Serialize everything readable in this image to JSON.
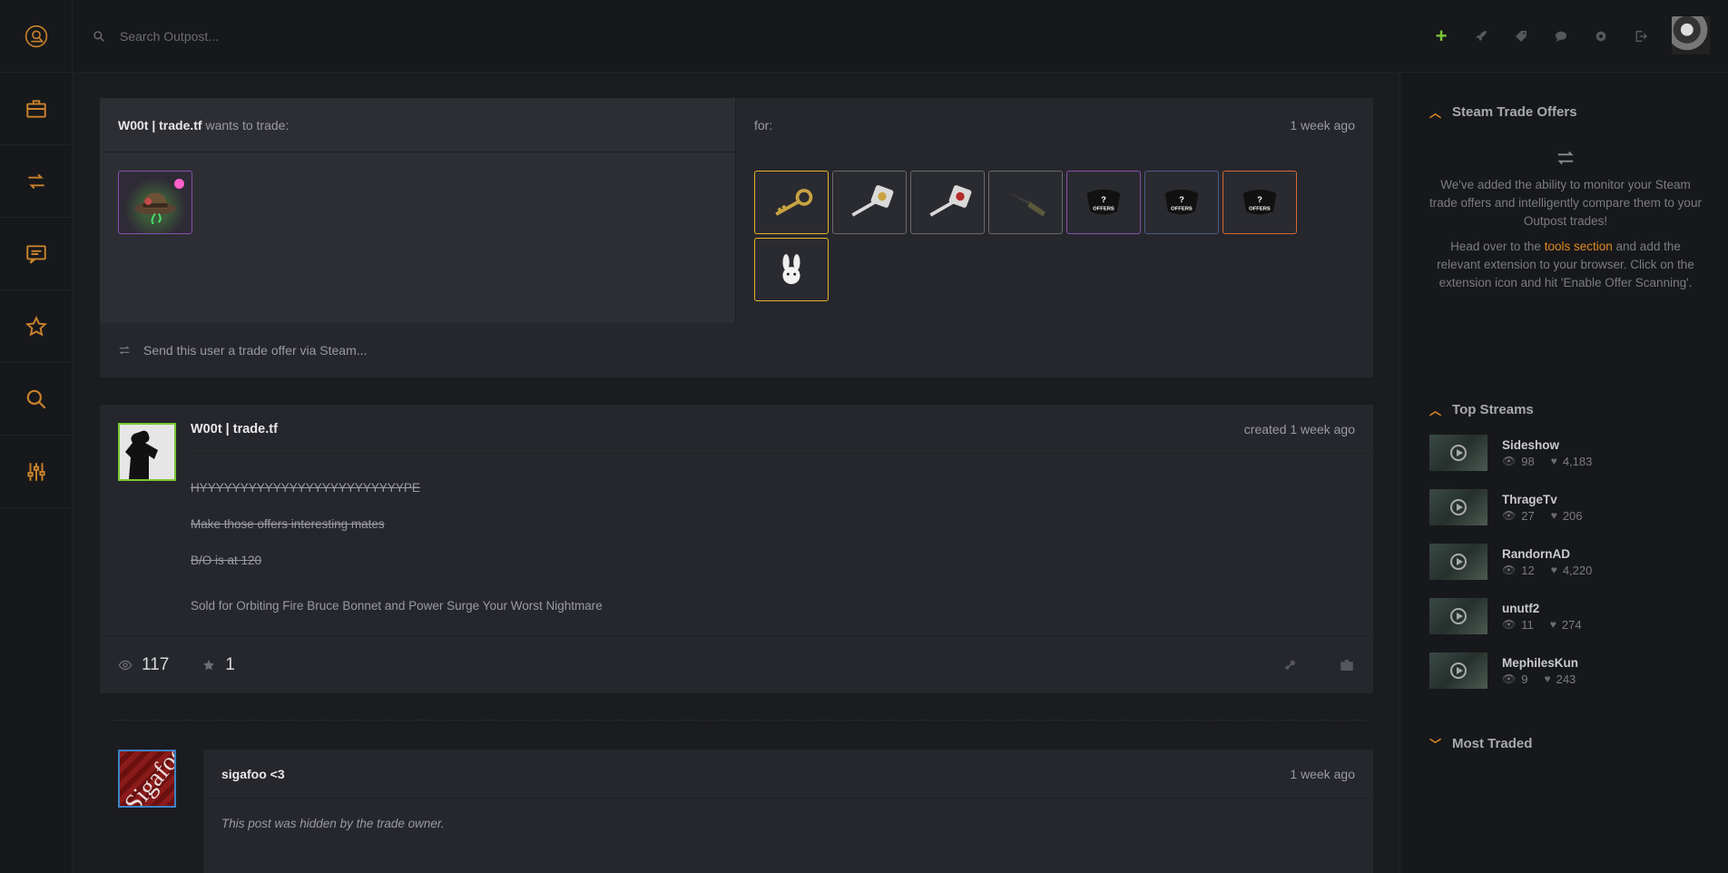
{
  "search": {
    "placeholder": "Search Outpost..."
  },
  "trade": {
    "user": "W00t | trade.tf",
    "wants_text": "wants to trade:",
    "for_text": "for:",
    "time": "1 week ago",
    "send_offer": "Send this user a trade offer via Steam..."
  },
  "post": {
    "user": "W00t | trade.tf",
    "created": "created 1 week ago",
    "lines": {
      "l1": "HYYYYYYYYYYYYYYYYYYYYYYYYYPE",
      "l2": "Make those offers interesting mates",
      "l3": "B/O is at 120",
      "l4": "Sold for Orbiting Fire Bruce Bonnet and Power Surge Your Worst Nightmare"
    },
    "views": "117",
    "stars": "1"
  },
  "comment": {
    "user": "sigafoo <3",
    "time": "1 week ago",
    "body": "This post was hidden by the trade owner.",
    "avatar_text": "Sigafoo"
  },
  "sidebar": {
    "steam_offers": {
      "title": "Steam Trade Offers",
      "p1": "We've added the ability to monitor your Steam trade offers and intelligently compare them to your Outpost trades!",
      "p2_a": "Head over to the",
      "p2_link": "tools section",
      "p2_b": "and add the relevant extension to your browser. Click on the extension icon and hit 'Enable Offer Scanning'."
    },
    "top_streams": {
      "title": "Top Streams",
      "items": [
        {
          "name": "Sideshow",
          "viewers": "98",
          "likes": "4,183"
        },
        {
          "name": "ThrageTv",
          "viewers": "27",
          "likes": "206"
        },
        {
          "name": "RandornAD",
          "viewers": "12",
          "likes": "4,220"
        },
        {
          "name": "unutf2",
          "viewers": "11",
          "likes": "274"
        },
        {
          "name": "MephilesKun",
          "viewers": "9",
          "likes": "243"
        }
      ]
    },
    "most_traded": {
      "title": "Most Traded"
    }
  },
  "colors": {
    "accent": "#e08a21",
    "plus": "#7cc636",
    "unusual": "#8650ac",
    "unique": "#ffd700",
    "strange": "#cf6a32",
    "genuine": "#4d7455"
  }
}
